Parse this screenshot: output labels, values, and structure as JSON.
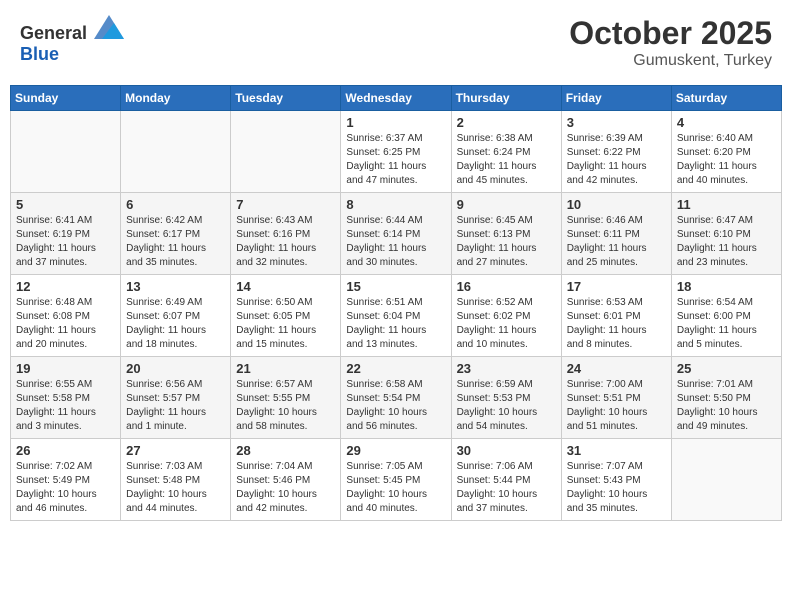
{
  "header": {
    "logo_general": "General",
    "logo_blue": "Blue",
    "month": "October 2025",
    "location": "Gumuskent, Turkey"
  },
  "weekdays": [
    "Sunday",
    "Monday",
    "Tuesday",
    "Wednesday",
    "Thursday",
    "Friday",
    "Saturday"
  ],
  "weeks": [
    [
      {
        "day": "",
        "info": ""
      },
      {
        "day": "",
        "info": ""
      },
      {
        "day": "",
        "info": ""
      },
      {
        "day": "1",
        "info": "Sunrise: 6:37 AM\nSunset: 6:25 PM\nDaylight: 11 hours\nand 47 minutes."
      },
      {
        "day": "2",
        "info": "Sunrise: 6:38 AM\nSunset: 6:24 PM\nDaylight: 11 hours\nand 45 minutes."
      },
      {
        "day": "3",
        "info": "Sunrise: 6:39 AM\nSunset: 6:22 PM\nDaylight: 11 hours\nand 42 minutes."
      },
      {
        "day": "4",
        "info": "Sunrise: 6:40 AM\nSunset: 6:20 PM\nDaylight: 11 hours\nand 40 minutes."
      }
    ],
    [
      {
        "day": "5",
        "info": "Sunrise: 6:41 AM\nSunset: 6:19 PM\nDaylight: 11 hours\nand 37 minutes."
      },
      {
        "day": "6",
        "info": "Sunrise: 6:42 AM\nSunset: 6:17 PM\nDaylight: 11 hours\nand 35 minutes."
      },
      {
        "day": "7",
        "info": "Sunrise: 6:43 AM\nSunset: 6:16 PM\nDaylight: 11 hours\nand 32 minutes."
      },
      {
        "day": "8",
        "info": "Sunrise: 6:44 AM\nSunset: 6:14 PM\nDaylight: 11 hours\nand 30 minutes."
      },
      {
        "day": "9",
        "info": "Sunrise: 6:45 AM\nSunset: 6:13 PM\nDaylight: 11 hours\nand 27 minutes."
      },
      {
        "day": "10",
        "info": "Sunrise: 6:46 AM\nSunset: 6:11 PM\nDaylight: 11 hours\nand 25 minutes."
      },
      {
        "day": "11",
        "info": "Sunrise: 6:47 AM\nSunset: 6:10 PM\nDaylight: 11 hours\nand 23 minutes."
      }
    ],
    [
      {
        "day": "12",
        "info": "Sunrise: 6:48 AM\nSunset: 6:08 PM\nDaylight: 11 hours\nand 20 minutes."
      },
      {
        "day": "13",
        "info": "Sunrise: 6:49 AM\nSunset: 6:07 PM\nDaylight: 11 hours\nand 18 minutes."
      },
      {
        "day": "14",
        "info": "Sunrise: 6:50 AM\nSunset: 6:05 PM\nDaylight: 11 hours\nand 15 minutes."
      },
      {
        "day": "15",
        "info": "Sunrise: 6:51 AM\nSunset: 6:04 PM\nDaylight: 11 hours\nand 13 minutes."
      },
      {
        "day": "16",
        "info": "Sunrise: 6:52 AM\nSunset: 6:02 PM\nDaylight: 11 hours\nand 10 minutes."
      },
      {
        "day": "17",
        "info": "Sunrise: 6:53 AM\nSunset: 6:01 PM\nDaylight: 11 hours\nand 8 minutes."
      },
      {
        "day": "18",
        "info": "Sunrise: 6:54 AM\nSunset: 6:00 PM\nDaylight: 11 hours\nand 5 minutes."
      }
    ],
    [
      {
        "day": "19",
        "info": "Sunrise: 6:55 AM\nSunset: 5:58 PM\nDaylight: 11 hours\nand 3 minutes."
      },
      {
        "day": "20",
        "info": "Sunrise: 6:56 AM\nSunset: 5:57 PM\nDaylight: 11 hours\nand 1 minute."
      },
      {
        "day": "21",
        "info": "Sunrise: 6:57 AM\nSunset: 5:55 PM\nDaylight: 10 hours\nand 58 minutes."
      },
      {
        "day": "22",
        "info": "Sunrise: 6:58 AM\nSunset: 5:54 PM\nDaylight: 10 hours\nand 56 minutes."
      },
      {
        "day": "23",
        "info": "Sunrise: 6:59 AM\nSunset: 5:53 PM\nDaylight: 10 hours\nand 54 minutes."
      },
      {
        "day": "24",
        "info": "Sunrise: 7:00 AM\nSunset: 5:51 PM\nDaylight: 10 hours\nand 51 minutes."
      },
      {
        "day": "25",
        "info": "Sunrise: 7:01 AM\nSunset: 5:50 PM\nDaylight: 10 hours\nand 49 minutes."
      }
    ],
    [
      {
        "day": "26",
        "info": "Sunrise: 7:02 AM\nSunset: 5:49 PM\nDaylight: 10 hours\nand 46 minutes."
      },
      {
        "day": "27",
        "info": "Sunrise: 7:03 AM\nSunset: 5:48 PM\nDaylight: 10 hours\nand 44 minutes."
      },
      {
        "day": "28",
        "info": "Sunrise: 7:04 AM\nSunset: 5:46 PM\nDaylight: 10 hours\nand 42 minutes."
      },
      {
        "day": "29",
        "info": "Sunrise: 7:05 AM\nSunset: 5:45 PM\nDaylight: 10 hours\nand 40 minutes."
      },
      {
        "day": "30",
        "info": "Sunrise: 7:06 AM\nSunset: 5:44 PM\nDaylight: 10 hours\nand 37 minutes."
      },
      {
        "day": "31",
        "info": "Sunrise: 7:07 AM\nSunset: 5:43 PM\nDaylight: 10 hours\nand 35 minutes."
      },
      {
        "day": "",
        "info": ""
      }
    ]
  ]
}
